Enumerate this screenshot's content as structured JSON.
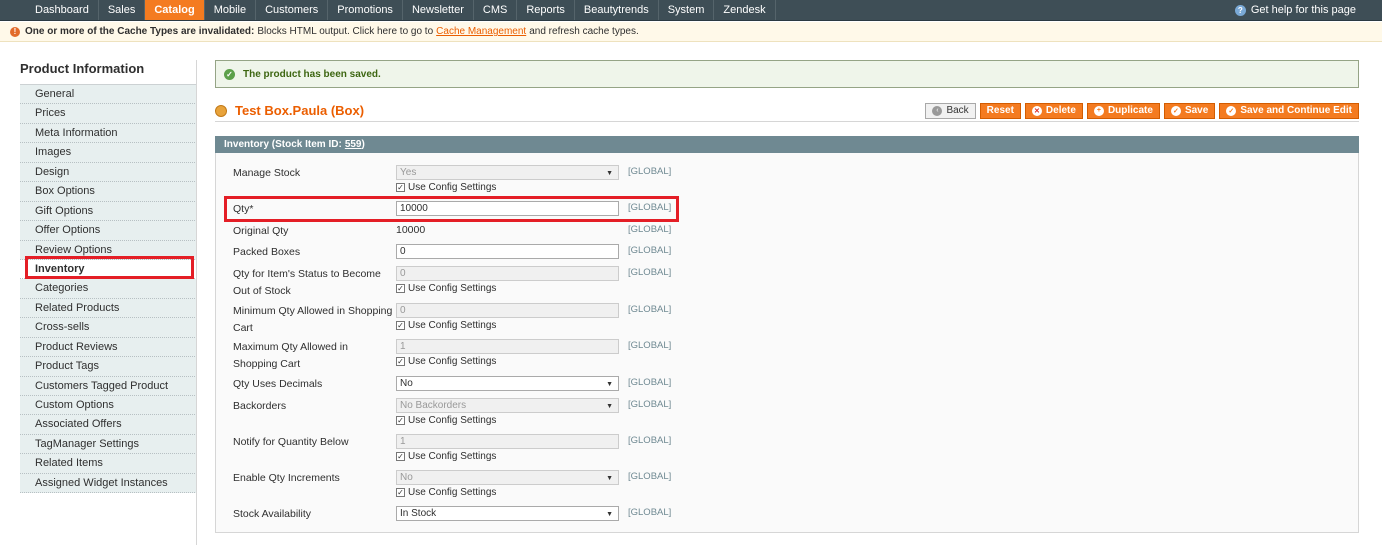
{
  "nav": {
    "items": [
      "Dashboard",
      "Sales",
      "Catalog",
      "Mobile",
      "Customers",
      "Promotions",
      "Newsletter",
      "CMS",
      "Reports",
      "Beautytrends",
      "System",
      "Zendesk"
    ],
    "active_index": 2,
    "help": "Get help for this page"
  },
  "notice": {
    "bold": "One or more of the Cache Types are invalidated:",
    "text1": "Blocks HTML output. Click here to go to",
    "link": "Cache Management",
    "text2": "and refresh cache types."
  },
  "sidebar": {
    "title": "Product Information",
    "items": [
      "General",
      "Prices",
      "Meta Information",
      "Images",
      "Design",
      "Box Options",
      "Gift Options",
      "Offer Options",
      "Review Options",
      "Inventory",
      "Categories",
      "Related Products",
      "Cross-sells",
      "Product Reviews",
      "Product Tags",
      "Customers Tagged Product",
      "Custom Options",
      "Associated Offers",
      "TagManager Settings",
      "Related Items",
      "Assigned Widget Instances"
    ],
    "active_index": 9
  },
  "success": "The product has been saved.",
  "product_title": "Test Box.Paula (Box)",
  "buttons": {
    "back": "Back",
    "reset": "Reset",
    "delete": "Delete",
    "duplicate": "Duplicate",
    "save": "Save",
    "save_continue": "Save and Continue Edit"
  },
  "section": {
    "title": "Inventory (Stock Item ID:",
    "id": "559",
    "close": ")"
  },
  "scope": "[GLOBAL]",
  "config_label": "Use Config Settings",
  "fields": {
    "manage_stock": {
      "label": "Manage Stock",
      "value": "Yes"
    },
    "qty": {
      "label": "Qty*",
      "value": "10000"
    },
    "original_qty": {
      "label": "Original Qty",
      "value": "10000"
    },
    "packed_boxes": {
      "label": "Packed Boxes",
      "value": "0"
    },
    "out_of_stock": {
      "label1": "Qty for Item's Status to Become",
      "label2": "Out of Stock",
      "value": "0"
    },
    "min_qty": {
      "label1": "Minimum Qty Allowed in Shopping",
      "label2": "Cart",
      "value": "0"
    },
    "max_qty": {
      "label1": "Maximum Qty Allowed in",
      "label2": "Shopping Cart",
      "value": "1"
    },
    "decimals": {
      "label": "Qty Uses Decimals",
      "value": "No"
    },
    "backorders": {
      "label": "Backorders",
      "value": "No Backorders"
    },
    "notify": {
      "label": "Notify for Quantity Below",
      "value": "1"
    },
    "increments": {
      "label": "Enable Qty Increments",
      "value": "No"
    },
    "availability": {
      "label": "Stock Availability",
      "value": "In Stock"
    }
  }
}
